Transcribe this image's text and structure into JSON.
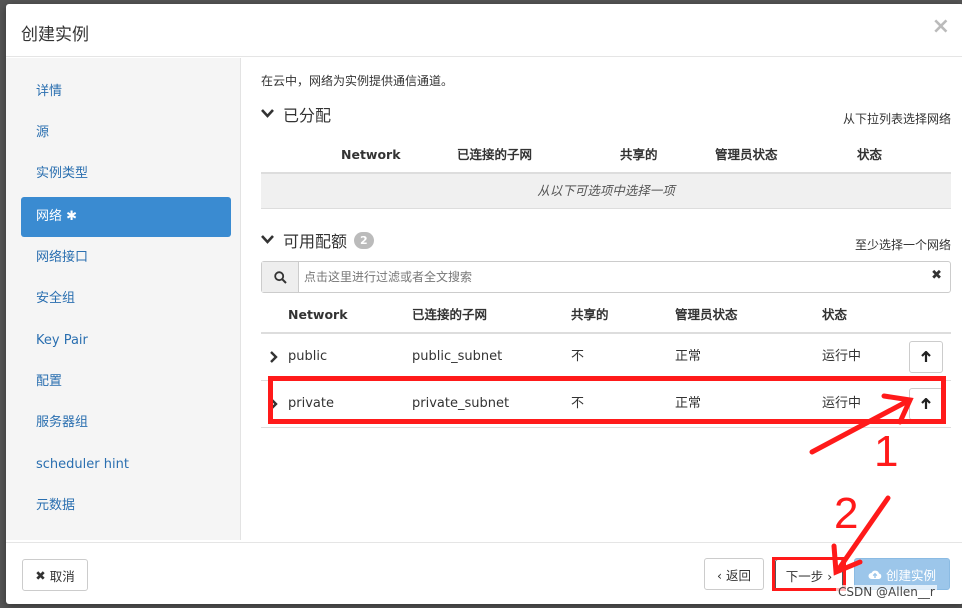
{
  "dialog": {
    "title": "创建实例",
    "close": "×",
    "help": "?"
  },
  "sidebar": {
    "items": [
      {
        "label": "详情"
      },
      {
        "label": "源"
      },
      {
        "label": "实例类型"
      },
      {
        "label": "网络 ✱"
      },
      {
        "label": "网络接口"
      },
      {
        "label": "安全组"
      },
      {
        "label": "Key Pair"
      },
      {
        "label": "配置"
      },
      {
        "label": "服务器组"
      },
      {
        "label": "scheduler hint"
      },
      {
        "label": "元数据"
      }
    ],
    "active_index": 3
  },
  "main": {
    "intro": "在云中，网络为实例提供通信通道。",
    "allocated": {
      "title": "已分配",
      "hint": "从下拉列表选择网络",
      "columns": [
        "Network",
        "已连接的子网",
        "共享的",
        "管理员状态",
        "状态"
      ],
      "empty_text": "从以下可选项中选择一项"
    },
    "available": {
      "title": "可用配额",
      "count": "2",
      "hint": "至少选择一个网络",
      "search_placeholder": "点击这里进行过滤或者全文搜索",
      "columns": [
        "Network",
        "已连接的子网",
        "共享的",
        "管理员状态",
        "状态"
      ],
      "rows": [
        {
          "network": "public",
          "subnet": "public_subnet",
          "shared": "不",
          "admin_state": "正常",
          "status": "运行中"
        },
        {
          "network": "private",
          "subnet": "private_subnet",
          "shared": "不",
          "admin_state": "正常",
          "status": "运行中"
        }
      ]
    }
  },
  "footer": {
    "cancel": "取消",
    "back": "‹ 返回",
    "next": "下一步 ›",
    "create": "创建实例"
  },
  "annotations": {
    "label1": "1",
    "label2": "2",
    "color": "#ff1a1a"
  },
  "watermark": "CSDN @Allen__r"
}
